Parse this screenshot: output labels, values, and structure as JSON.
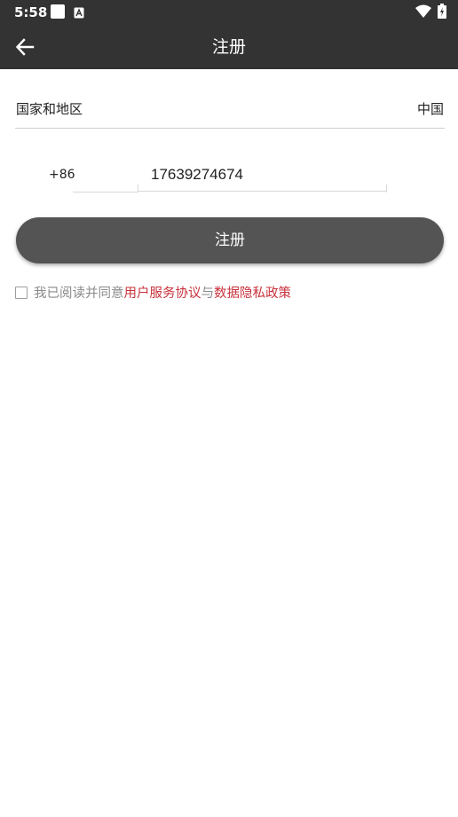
{
  "status_bar": {
    "time": "5:58",
    "icons": [
      "notification-square-icon",
      "font-app-icon",
      "wifi-icon",
      "battery-charging-icon"
    ]
  },
  "toolbar": {
    "back_icon": "arrow-left-icon",
    "title": "注册"
  },
  "region": {
    "label": "国家和地区",
    "value": "中国"
  },
  "phone": {
    "country_code": "+86",
    "number": "17639274674"
  },
  "register_button": {
    "label": "注册"
  },
  "agreement": {
    "checked": false,
    "prefix": "我已阅读并同意",
    "terms_link": "用户服务协议",
    "conjunction": "与",
    "privacy_link": "数据隐私政策"
  },
  "colors": {
    "toolbar_bg": "#333333",
    "button_bg": "#545454",
    "link_red": "#c8323c",
    "muted_text": "#8a8a8a"
  }
}
